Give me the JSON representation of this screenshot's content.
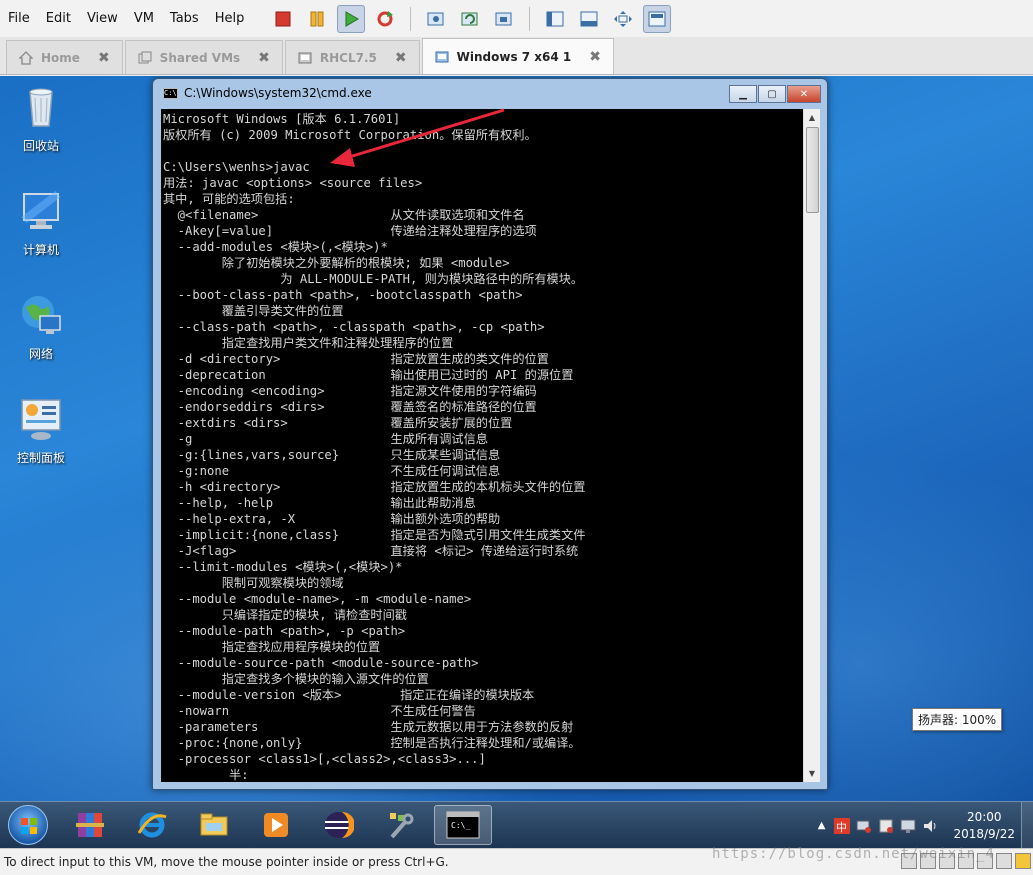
{
  "menubar": {
    "items": [
      "File",
      "Edit",
      "View",
      "VM",
      "Tabs",
      "Help"
    ]
  },
  "toolbar": {
    "buttons": [
      "power-off-icon",
      "suspend-icon",
      "power-on-icon",
      "restart-icon",
      "snapshot-icon",
      "revert-snapshot-icon",
      "snapshot-manager-icon",
      "library-icon",
      "console-view-icon",
      "fullscreen-icon",
      "unity-icon"
    ]
  },
  "tabs": [
    {
      "label": "Home",
      "icon": "home-icon"
    },
    {
      "label": "Shared VMs",
      "icon": "shared-vms-icon"
    },
    {
      "label": "RHCL7.5",
      "icon": "vm-icon"
    },
    {
      "label": "Windows 7 x64 1",
      "icon": "vm-icon",
      "active": true
    }
  ],
  "desktop": {
    "icons": [
      {
        "label": "回收站",
        "icon": "recycle-bin-icon"
      },
      {
        "label": "计算机",
        "icon": "computer-icon"
      },
      {
        "label": "网络",
        "icon": "network-icon"
      },
      {
        "label": "控制面板",
        "icon": "control-panel-icon"
      }
    ]
  },
  "cmd": {
    "title": "C:\\Windows\\system32\\cmd.exe",
    "lines": [
      "Microsoft Windows [版本 6.1.7601]",
      "版权所有 (c) 2009 Microsoft Corporation。保留所有权利。",
      "",
      "C:\\Users\\wenhs>javac",
      "用法: javac <options> <source files>",
      "其中, 可能的选项包括:",
      "  @<filename>                  从文件读取选项和文件名",
      "  -Akey[=value]                传递给注释处理程序的选项",
      "  --add-modules <模块>(,<模块>)*",
      "        除了初始模块之外要解析的根模块; 如果 <module>",
      "                为 ALL-MODULE-PATH, 则为模块路径中的所有模块。",
      "  --boot-class-path <path>, -bootclasspath <path>",
      "        覆盖引导类文件的位置",
      "  --class-path <path>, -classpath <path>, -cp <path>",
      "        指定查找用户类文件和注释处理程序的位置",
      "  -d <directory>               指定放置生成的类文件的位置",
      "  -deprecation                 输出使用已过时的 API 的源位置",
      "  -encoding <encoding>         指定源文件使用的字符编码",
      "  -endorseddirs <dirs>         覆盖签名的标准路径的位置",
      "  -extdirs <dirs>              覆盖所安装扩展的位置",
      "  -g                           生成所有调试信息",
      "  -g:{lines,vars,source}       只生成某些调试信息",
      "  -g:none                      不生成任何调试信息",
      "  -h <directory>               指定放置生成的本机标头文件的位置",
      "  --help, -help                输出此帮助消息",
      "  --help-extra, -X             输出额外选项的帮助",
      "  -implicit:{none,class}       指定是否为隐式引用文件生成类文件",
      "  -J<flag>                     直接将 <标记> 传递给运行时系统",
      "  --limit-modules <模块>(,<模块>)*",
      "        限制可观察模块的领域",
      "  --module <module-name>, -m <module-name>",
      "        只编译指定的模块, 请检查时间戳",
      "  --module-path <path>, -p <path>",
      "        指定查找应用程序模块的位置",
      "  --module-source-path <module-source-path>",
      "        指定查找多个模块的输入源文件的位置",
      "  --module-version <版本>        指定正在编译的模块版本",
      "  -nowarn                      不生成任何警告",
      "  -parameters                  生成元数据以用于方法参数的反射",
      "  -proc:{none,only}            控制是否执行注释处理和/或编译。",
      "  -processor <class1>[,<class2>,<class3>...]",
      "         半:"
    ]
  },
  "taskbar": {
    "apps": [
      "winrar-icon",
      "ie-icon",
      "explorer-icon",
      "media-player-icon",
      "eclipse-icon",
      "tools-icon",
      "cmd-icon"
    ],
    "tooltip": "扬声器: 100%",
    "clock_time": "20:00",
    "clock_date": "2018/9/22"
  },
  "statusbar": {
    "text": "To direct input to this VM, move the mouse pointer inside or press Ctrl+G."
  },
  "watermark": "https://blog.csdn.net/weixin_4"
}
